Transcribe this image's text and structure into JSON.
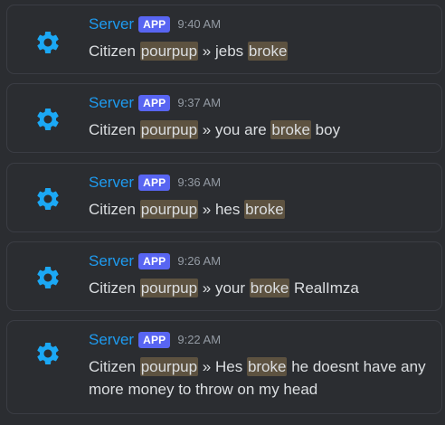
{
  "messages": [
    {
      "author": "Server",
      "badge": "APP",
      "time": "9:40 AM",
      "parts": [
        "Citizen ",
        "pourpup",
        " » jebs ",
        "broke",
        ""
      ]
    },
    {
      "author": "Server",
      "badge": "APP",
      "time": "9:37 AM",
      "parts": [
        "Citizen ",
        "pourpup",
        " » you are ",
        "broke",
        " boy"
      ]
    },
    {
      "author": "Server",
      "badge": "APP",
      "time": "9:36 AM",
      "parts": [
        "Citizen ",
        "pourpup",
        " » hes ",
        "broke",
        ""
      ]
    },
    {
      "author": "Server",
      "badge": "APP",
      "time": "9:26 AM",
      "parts": [
        "Citizen ",
        "pourpup",
        " » your ",
        "broke",
        " RealImza"
      ]
    },
    {
      "author": "Server",
      "badge": "APP",
      "time": "9:22 AM",
      "parts": [
        "Citizen ",
        "pourpup",
        " » Hes ",
        "broke",
        " he doesnt have any more money to throw on my head"
      ]
    }
  ],
  "colors": {
    "background": "#2b2d31",
    "author": "#1e9bf0",
    "badge": "#5865f2",
    "timestamp": "#949ba4",
    "text": "#dbdee1",
    "highlight": "#5d5240",
    "avatar_icon": "#1ba8f5"
  },
  "icons": {
    "avatar": "gear-icon"
  }
}
